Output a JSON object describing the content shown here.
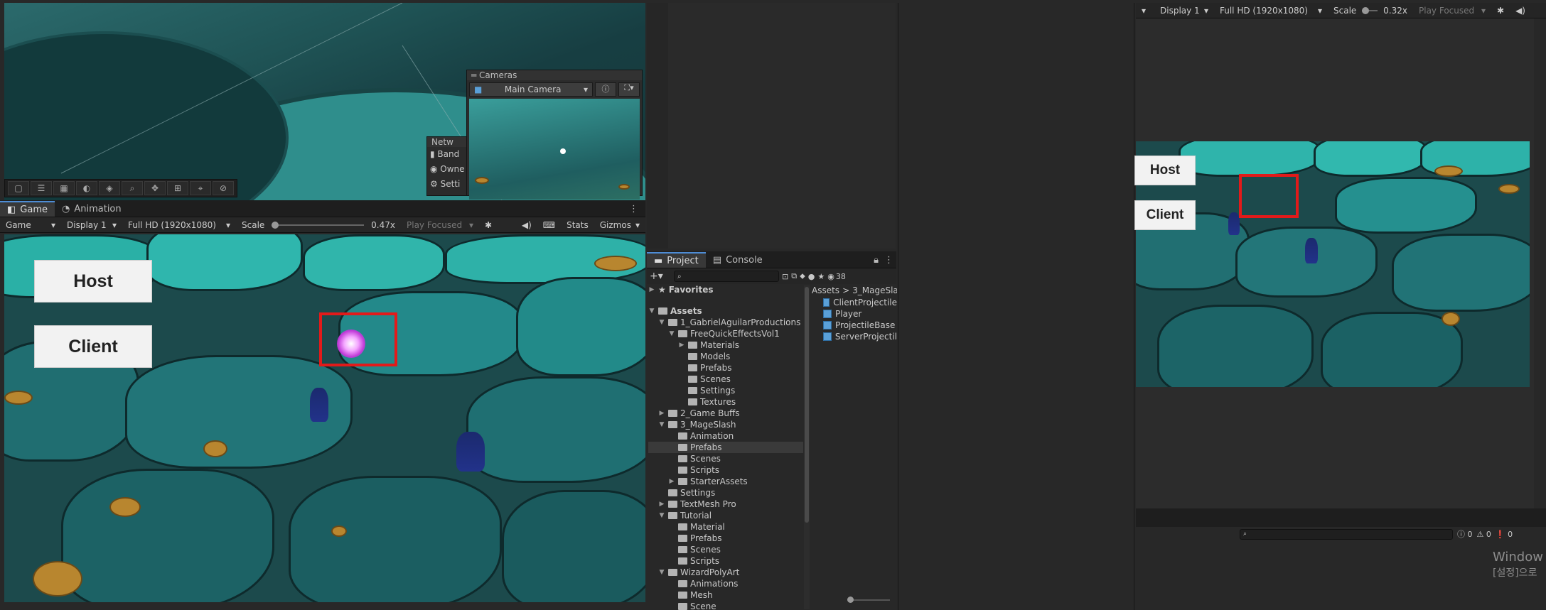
{
  "scene_view": {
    "overlays": {
      "cameras_title": "Cameras",
      "camera_select": "Main Camera",
      "network_title": "Netw",
      "network_items": [
        "Band",
        "Owne",
        "Setti"
      ]
    }
  },
  "game_tabs": [
    {
      "label": "Game",
      "icon": "gamepad-icon",
      "active": true
    },
    {
      "label": "Animation",
      "icon": "animation-icon",
      "active": false
    }
  ],
  "left_gamebar": {
    "mode": "Game",
    "display": "Display 1",
    "resolution": "Full HD (1920x1080)",
    "scale_label": "Scale",
    "scale_value": "0.47x",
    "play_focused": "Play Focused",
    "stats": "Stats",
    "gizmos": "Gizmos"
  },
  "left_game": {
    "host_label": "Host",
    "client_label": "Client"
  },
  "project_panel": {
    "tabs": [
      {
        "label": "Project",
        "icon": "folder-icon",
        "active": true
      },
      {
        "label": "Console",
        "icon": "console-icon",
        "active": false
      }
    ],
    "search_placeholder": "",
    "hidden_count": "38",
    "favorites_label": "Favorites",
    "tree": [
      {
        "label": "Assets",
        "depth": 0,
        "arrow": "open",
        "bold": true
      },
      {
        "label": "1_GabrielAguilarProductions",
        "depth": 1,
        "arrow": "open"
      },
      {
        "label": "FreeQuickEffectsVol1",
        "depth": 2,
        "arrow": "open"
      },
      {
        "label": "Materials",
        "depth": 3,
        "arrow": "closed"
      },
      {
        "label": "Models",
        "depth": 3,
        "arrow": "none"
      },
      {
        "label": "Prefabs",
        "depth": 3,
        "arrow": "none"
      },
      {
        "label": "Scenes",
        "depth": 3,
        "arrow": "none"
      },
      {
        "label": "Settings",
        "depth": 3,
        "arrow": "none"
      },
      {
        "label": "Textures",
        "depth": 3,
        "arrow": "none"
      },
      {
        "label": "2_Game Buffs",
        "depth": 1,
        "arrow": "closed"
      },
      {
        "label": "3_MageSlash",
        "depth": 1,
        "arrow": "open"
      },
      {
        "label": "Animation",
        "depth": 2,
        "arrow": "none"
      },
      {
        "label": "Prefabs",
        "depth": 2,
        "arrow": "none",
        "selected": true
      },
      {
        "label": "Scenes",
        "depth": 2,
        "arrow": "none"
      },
      {
        "label": "Scripts",
        "depth": 2,
        "arrow": "none"
      },
      {
        "label": "StarterAssets",
        "depth": 2,
        "arrow": "closed"
      },
      {
        "label": "Settings",
        "depth": 1,
        "arrow": "none"
      },
      {
        "label": "TextMesh Pro",
        "depth": 1,
        "arrow": "closed"
      },
      {
        "label": "Tutorial",
        "depth": 1,
        "arrow": "open"
      },
      {
        "label": "Material",
        "depth": 2,
        "arrow": "none"
      },
      {
        "label": "Prefabs",
        "depth": 2,
        "arrow": "none"
      },
      {
        "label": "Scenes",
        "depth": 2,
        "arrow": "none"
      },
      {
        "label": "Scripts",
        "depth": 2,
        "arrow": "none"
      },
      {
        "label": "WizardPolyArt",
        "depth": 1,
        "arrow": "open"
      },
      {
        "label": "Animations",
        "depth": 2,
        "arrow": "none"
      },
      {
        "label": "Mesh",
        "depth": 2,
        "arrow": "none"
      },
      {
        "label": "Scene",
        "depth": 2,
        "arrow": "none"
      }
    ],
    "breadcrumb": [
      "Assets",
      "3_MageSla"
    ],
    "breadcrumb_sep": ">",
    "assets": [
      "ClientProjectile",
      "Player",
      "ProjectileBase",
      "ServerProjectil"
    ]
  },
  "right_gamebar": {
    "display": "Display 1",
    "resolution": "Full HD (1920x1080)",
    "scale_label": "Scale",
    "scale_value": "0.32x",
    "play_focused": "Play Focused"
  },
  "right_game": {
    "host_label": "Host",
    "client_label": "Client"
  },
  "right_console": {
    "count_info": "0",
    "count_warn": "0",
    "count_error": "0"
  },
  "windows_watermark": {
    "line1": "Window",
    "line2": "[설정]으로"
  }
}
